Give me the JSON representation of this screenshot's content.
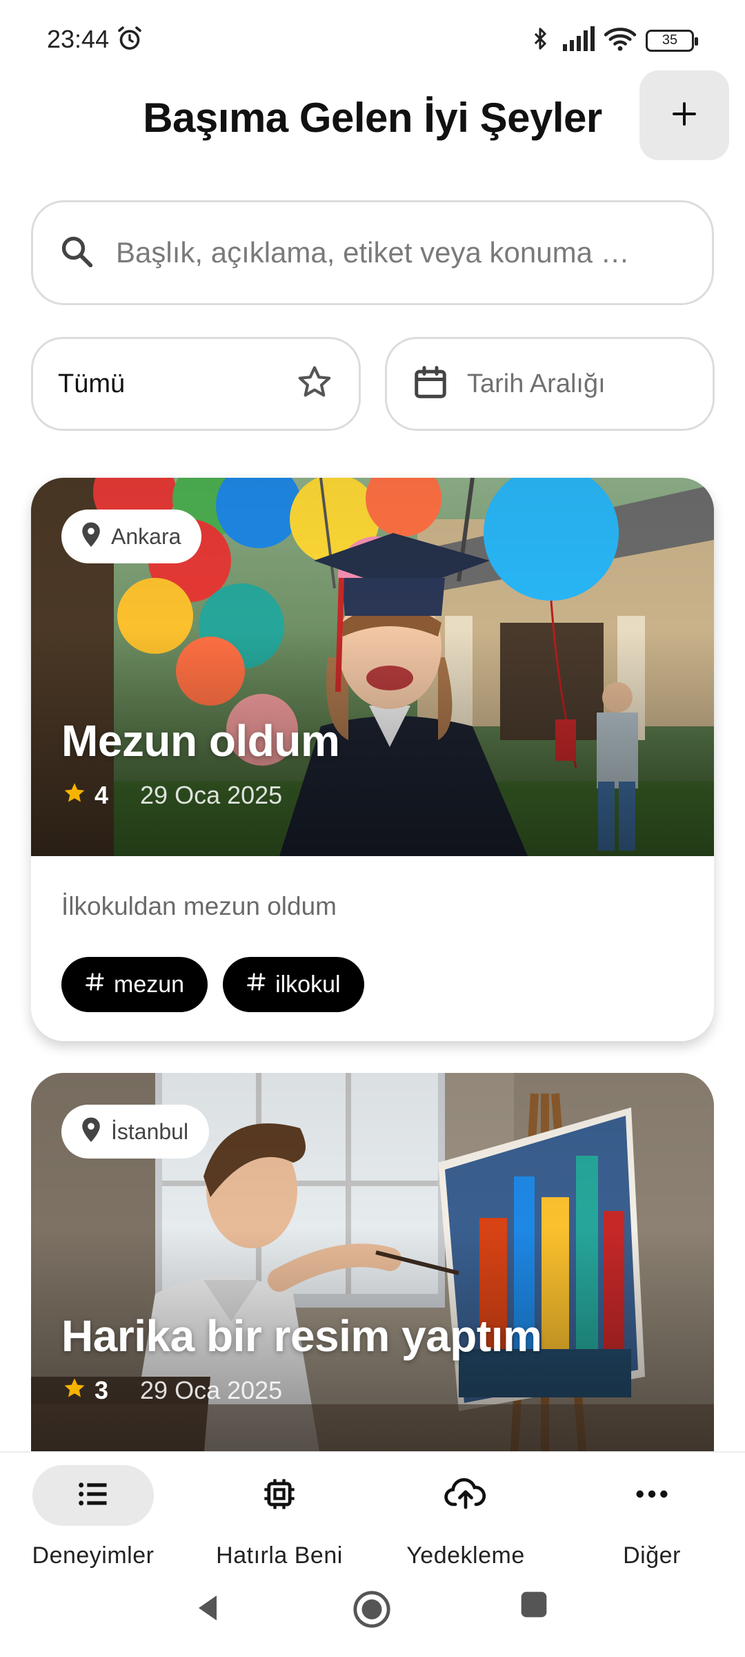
{
  "status_bar": {
    "time": "23:44",
    "battery": "35"
  },
  "header": {
    "title": "Başıma Gelen İyi Şeyler",
    "add_icon": "plus-icon"
  },
  "search": {
    "placeholder": "Başlık, açıklama, etiket veya konuma …",
    "value": ""
  },
  "filters": {
    "favorites": {
      "label": "Tümü",
      "icon": "star-outline-icon"
    },
    "date_range": {
      "label": "Tarih Aralığı",
      "icon": "calendar-icon"
    }
  },
  "experiences": [
    {
      "location": "Ankara",
      "title": "Mezun oldum",
      "rating": "4",
      "date": "29 Oca 2025",
      "description": "İlkokuldan mezun oldum",
      "tags": [
        "mezun",
        "ilkokul"
      ]
    },
    {
      "location": "İstanbul",
      "title": "Harika bir resim yaptım",
      "rating": "3",
      "date": "29 Oca 2025"
    }
  ],
  "nav": [
    {
      "label": "Deneyimler",
      "icon": "list-icon",
      "active": true
    },
    {
      "label": "Hatırla Beni",
      "icon": "chip-icon",
      "active": false
    },
    {
      "label": "Yedekleme",
      "icon": "cloud-upload-icon",
      "active": false
    },
    {
      "label": "Diğer",
      "icon": "more-icon",
      "active": false
    }
  ],
  "colors": {
    "accent": "#000000",
    "star": "#f5b400",
    "chip_bg": "#e9e9e9"
  }
}
